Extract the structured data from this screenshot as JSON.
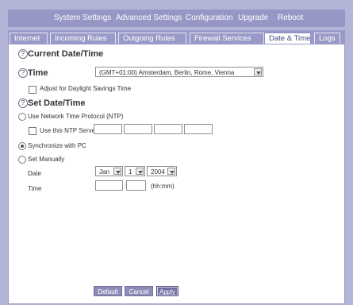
{
  "top_nav": [
    "System Settings",
    "Advanced Settings",
    "Configuration",
    "Upgrade",
    "Reboot"
  ],
  "sub_tabs": [
    "Internet",
    "Incoming Rules",
    "Outgoing Rules",
    "Firewall Services",
    "Date & Time",
    "Logs"
  ],
  "active_sub_tab": "Date & Time",
  "current_section": {
    "title": "Current Date/Time",
    "time_label": "Time",
    "timezone_value": "(GMT+01:00) Amsterdam, Berlin, Rome, Vienna",
    "dst_label": "Adjust for Daylight Savings Time"
  },
  "set_section": {
    "title": "Set Date/Time",
    "ntp_label": "Use Network Time Protocol (NTP)",
    "ntp_server_label": "Use this NTP Server",
    "sync_pc_label": "Synchronize with PC",
    "manual_label": "Set Manually",
    "date_label": "Date",
    "month_value": "Jan",
    "day_value": "1",
    "year_value": "2004",
    "time_label": "Time",
    "time_separator": ":",
    "time_format": "(hh:mm)"
  },
  "buttons": {
    "default": "Default",
    "cancel": "Cancel",
    "apply": "Apply"
  }
}
